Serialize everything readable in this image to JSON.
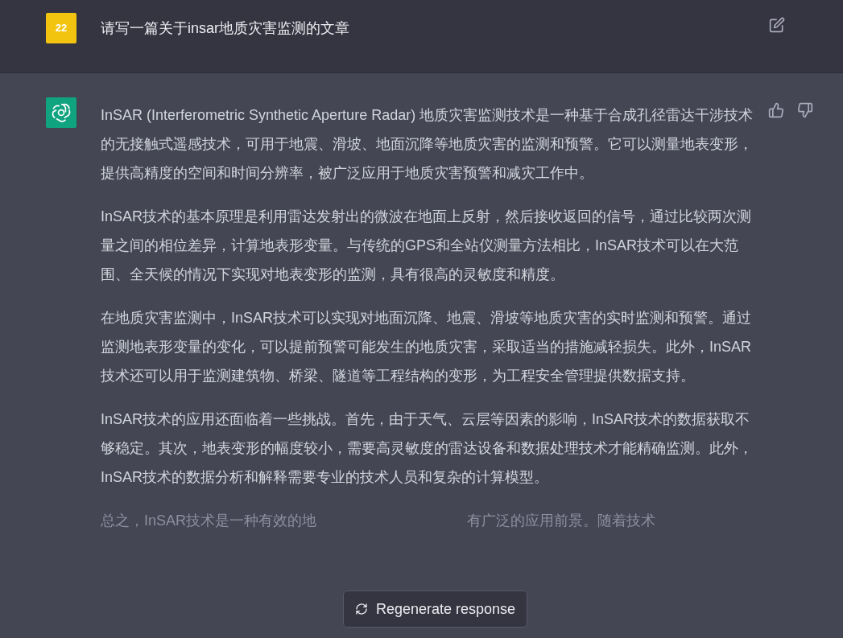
{
  "user_message": {
    "avatar": "22",
    "text": "请写一篇关于insar地质灾害监测的文章"
  },
  "assistant_message": {
    "paragraphs": [
      "InSAR (Interferometric Synthetic Aperture Radar) 地质灾害监测技术是一种基于合成孔径雷达干涉技术的无接触式遥感技术，可用于地震、滑坡、地面沉降等地质灾害的监测和预警。它可以测量地表变形，提供高精度的空间和时间分辨率，被广泛应用于地质灾害预警和减灾工作中。",
      "InSAR技术的基本原理是利用雷达发射出的微波在地面上反射，然后接收返回的信号，通过比较两次测量之间的相位差异，计算地表形变量。与传统的GPS和全站仪测量方法相比，InSAR技术可以在大范围、全天候的情况下实现对地表变形的监测，具有很高的灵敏度和精度。",
      "在地质灾害监测中，InSAR技术可以实现对地面沉降、地震、滑坡等地质灾害的实时监测和预警。通过监测地表形变量的变化，可以提前预警可能发生的地质灾害，采取适当的措施减轻损失。此外，InSAR技术还可以用于监测建筑物、桥梁、隧道等工程结构的变形，为工程安全管理提供数据支持。",
      "InSAR技术的应用还面临着一些挑战。首先，由于天气、云层等因素的影响，InSAR技术的数据获取不够稳定。其次，地表变形的幅度较小，需要高灵敏度的雷达设备和数据处理技术才能精确监测。此外，InSAR技术的数据分析和解释需要专业的技术人员和复杂的计算模型。"
    ],
    "faded_line": {
      "left": "总之，InSAR技术是一种有效的地",
      "right": "有广泛的应用前景。随着技术"
    }
  },
  "regenerate_button": {
    "label": "Regenerate response"
  }
}
